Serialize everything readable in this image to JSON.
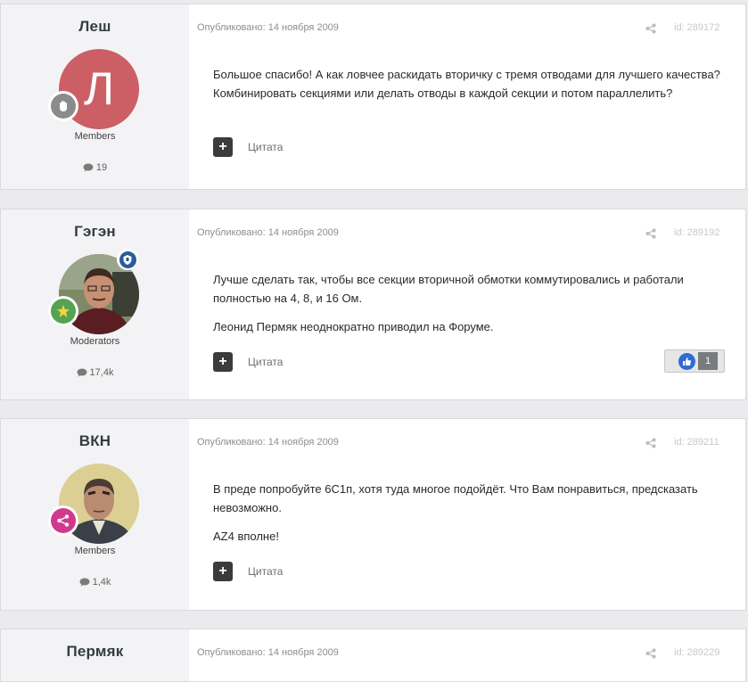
{
  "posts": [
    {
      "author": "Леш",
      "avatar_letter": "Л",
      "avatar_color": "#cc5f66",
      "rank_color": "#8b8b8b",
      "group": "Members",
      "post_count": "19",
      "published": "Опубликовано: 14 ноября 2009",
      "post_id": "id: 289172",
      "paragraphs": [
        "Большое спасибо! А как ловчее раскидать вторичку с тремя отводами для лучшего качества? Комбинировать секциями или делать отводы в каждой секции и потом параллелить?"
      ],
      "quote_label": "Цитата"
    },
    {
      "author": "Гэгэн",
      "avatar_icon": "user-photo",
      "rank_color": "#55a351",
      "moderator_badge_color": "#2d5a99",
      "group": "Moderators",
      "post_count": "17,4k",
      "published": "Опубликовано: 14 ноября 2009",
      "post_id": "id: 289192",
      "paragraphs": [
        "Лучше сделать так, чтобы все секции вторичной обмотки коммутировались и работали полностью на 4, 8, и 16 Ом.",
        "Леонид Пермяк неоднократно приводил на Форуме."
      ],
      "quote_label": "Цитата",
      "reaction_count": "1"
    },
    {
      "author": "ВКН",
      "avatar_icon": "user-photo",
      "rank_color": "#d03a8e",
      "group": "Members",
      "post_count": "1,4k",
      "published": "Опубликовано: 14 ноября 2009",
      "post_id": "id: 289211",
      "paragraphs": [
        "В преде попробуйте 6С1п, хотя туда многое подойдёт. Что Вам понравиться, предсказать невозможно.",
        "AZ4 вполне!"
      ],
      "quote_label": "Цитата"
    },
    {
      "author": "Пермяк",
      "published": "Опубликовано: 14 ноября 2009",
      "post_id": "id: 289229"
    }
  ]
}
